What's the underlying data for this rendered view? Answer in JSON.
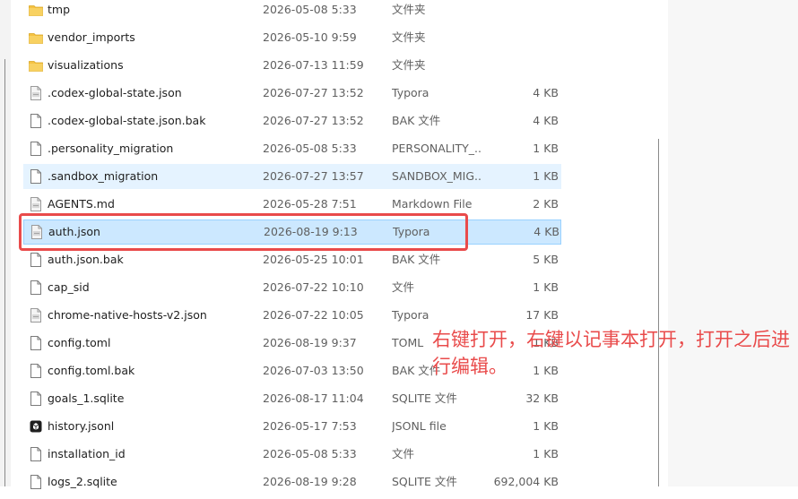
{
  "files": [
    {
      "name": "tmp",
      "date": "2026-05-08 5:33",
      "type": "文件夹",
      "size": "",
      "icon": "folder-icon",
      "state": ""
    },
    {
      "name": "vendor_imports",
      "date": "2026-05-10 9:59",
      "type": "文件夹",
      "size": "",
      "icon": "folder-icon",
      "state": ""
    },
    {
      "name": "visualizations",
      "date": "2026-07-13 11:59",
      "type": "文件夹",
      "size": "",
      "icon": "folder-icon",
      "state": ""
    },
    {
      "name": ".codex-global-state.json",
      "date": "2026-07-27 13:52",
      "type": "Typora",
      "size": "4 KB",
      "icon": "typora-file-icon",
      "state": ""
    },
    {
      "name": ".codex-global-state.json.bak",
      "date": "2026-07-27 13:52",
      "type": "BAK 文件",
      "size": "4 KB",
      "icon": "file-icon",
      "state": ""
    },
    {
      "name": ".personality_migration",
      "date": "2026-05-08 5:33",
      "type": "PERSONALITY_...",
      "size": "1 KB",
      "icon": "file-icon",
      "state": ""
    },
    {
      "name": ".sandbox_migration",
      "date": "2026-07-27 13:57",
      "type": "SANDBOX_MIG...",
      "size": "1 KB",
      "icon": "file-icon",
      "state": "hover"
    },
    {
      "name": "AGENTS.md",
      "date": "2026-05-28 7:51",
      "type": "Markdown File",
      "size": "2 KB",
      "icon": "typora-file-icon",
      "state": ""
    },
    {
      "name": "auth.json",
      "date": "2026-08-19 9:13",
      "type": "Typora",
      "size": "4 KB",
      "icon": "typora-file-icon",
      "state": "selected"
    },
    {
      "name": "auth.json.bak",
      "date": "2026-05-25 10:01",
      "type": "BAK 文件",
      "size": "5 KB",
      "icon": "file-icon",
      "state": ""
    },
    {
      "name": "cap_sid",
      "date": "2026-07-22 10:10",
      "type": "文件",
      "size": "1 KB",
      "icon": "file-icon",
      "state": ""
    },
    {
      "name": "chrome-native-hosts-v2.json",
      "date": "2026-07-22 10:05",
      "type": "Typora",
      "size": "17 KB",
      "icon": "typora-file-icon",
      "state": ""
    },
    {
      "name": "config.toml",
      "date": "2026-08-19 9:37",
      "type": "TOML",
      "size": "1 KB",
      "icon": "file-icon",
      "state": ""
    },
    {
      "name": "config.toml.bak",
      "date": "2026-07-03 13:50",
      "type": "BAK 文件",
      "size": "1 KB",
      "icon": "file-icon",
      "state": ""
    },
    {
      "name": "goals_1.sqlite",
      "date": "2026-08-17 11:04",
      "type": "SQLITE 文件",
      "size": "32 KB",
      "icon": "file-icon",
      "state": ""
    },
    {
      "name": "history.jsonl",
      "date": "2026-05-17 7:53",
      "type": "JSONL file",
      "size": "1 KB",
      "icon": "jsonl-file-icon",
      "state": ""
    },
    {
      "name": "installation_id",
      "date": "2026-05-08 5:33",
      "type": "文件",
      "size": "1 KB",
      "icon": "file-icon",
      "state": ""
    },
    {
      "name": "logs_2.sqlite",
      "date": "2026-08-19 9:28",
      "type": "SQLITE 文件",
      "size": "692,004 KB",
      "icon": "file-icon",
      "state": ""
    }
  ],
  "annotation": {
    "text": "右键打开，右键以记事本打开，打开之后进行编辑。",
    "color": "#e94b4b"
  },
  "colors": {
    "folder": "#f5c242",
    "selected_row": "#cce8ff",
    "hover_row": "#e5f3ff"
  }
}
